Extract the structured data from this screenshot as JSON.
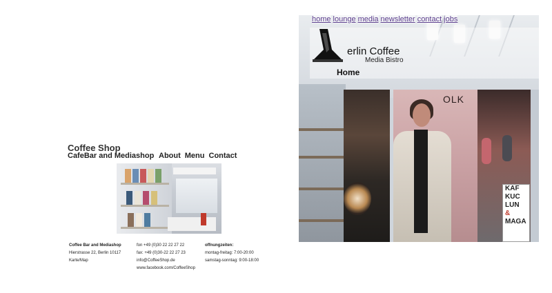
{
  "left_site": {
    "title": "Coffee Shop",
    "subtitle": "CafeBar and Mediashop",
    "nav": [
      {
        "label": "About"
      },
      {
        "label": "Menu"
      },
      {
        "label": "Contact"
      }
    ],
    "info": {
      "col1": {
        "name": "Coffee Bar and Mediashop",
        "address": "Hierstrasse 22, Berlin 10117",
        "map": "Karte/Map"
      },
      "col2": {
        "phone": "fon +49 (0)30 22 22 27 22",
        "fax": "fax: +49 (0)30-22 22 27 23",
        "email": "info@CoffeeShop.de",
        "web": "www.facebook.com/CoffeeShop"
      },
      "col3": {
        "heading": "offnungzeiten:",
        "weekdays": "montag-freitag: 7:00-20:00",
        "weekend": "samstag-sonntag: 9:00-18:00"
      }
    }
  },
  "right_site": {
    "nav": [
      {
        "label": "home"
      },
      {
        "label": "lounge"
      },
      {
        "label": "media"
      },
      {
        "label": "newsletter"
      },
      {
        "label": "contact"
      },
      {
        "label": "jobs"
      }
    ],
    "logo_name": "erlin Coffee",
    "logo_sub": "Media Bistro",
    "page_heading": "Home",
    "portrait_sign": "OLK",
    "street_sign": [
      "KAF",
      "KUC",
      "LUN",
      "&",
      "MAGA"
    ]
  },
  "colors": {
    "nav_link": "#5a3c8c",
    "text_dark": "#222222"
  }
}
